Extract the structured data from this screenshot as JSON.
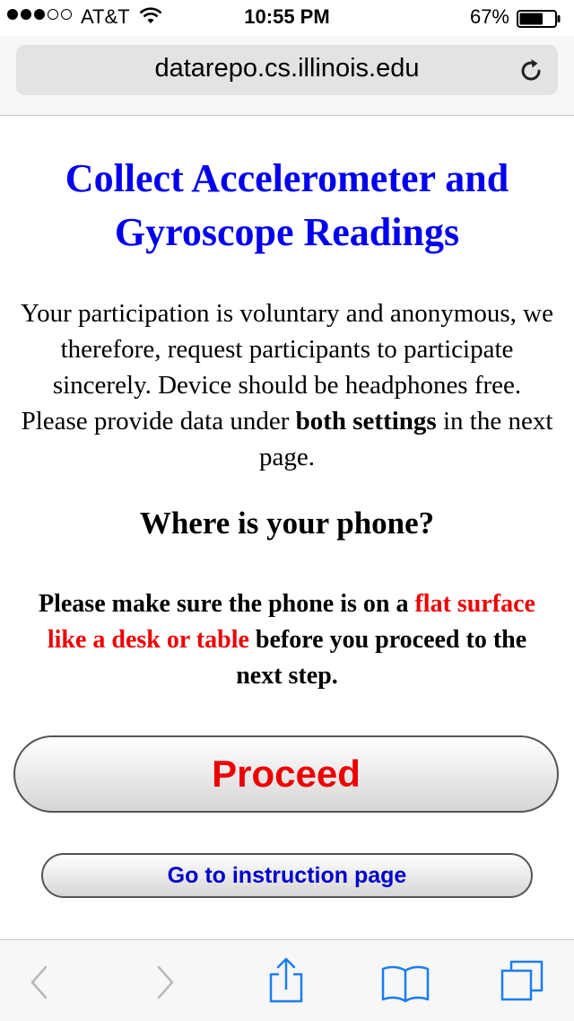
{
  "status_bar": {
    "carrier": "AT&T",
    "time": "10:55 PM",
    "battery": "67%",
    "battery_level": 0.67,
    "signal_bars": 3,
    "signal_total": 5
  },
  "address_bar": {
    "url": "datarepo.cs.illinois.edu",
    "reload_icon": "reload-icon"
  },
  "page": {
    "title": "Collect Accelerometer and Gyroscope Readings",
    "intro_before": "Your participation is voluntary and anonymous, we therefore, request participants to participate sincerely. Device should be headphones free. Please provide data under ",
    "intro_bold": "both settings",
    "intro_after": " in the next page.",
    "question": "Where is your phone?",
    "instruction_before": "Please make sure the phone is on a ",
    "instruction_highlight": "flat surface like a desk or table",
    "instruction_after": " before you proceed to the next step.",
    "proceed_label": "Proceed",
    "instruction_link_label": "Go to instruction page"
  },
  "toolbar": {
    "icons": [
      "back-icon",
      "forward-icon",
      "share-icon",
      "bookmarks-icon",
      "tabs-icon"
    ]
  },
  "colors": {
    "title": "#0000ee",
    "highlight": "#ee0000",
    "link_button_text": "#0000cc",
    "toolbar_tint": "#1a7df0",
    "toolbar_disabled": "#b8b8bc"
  }
}
